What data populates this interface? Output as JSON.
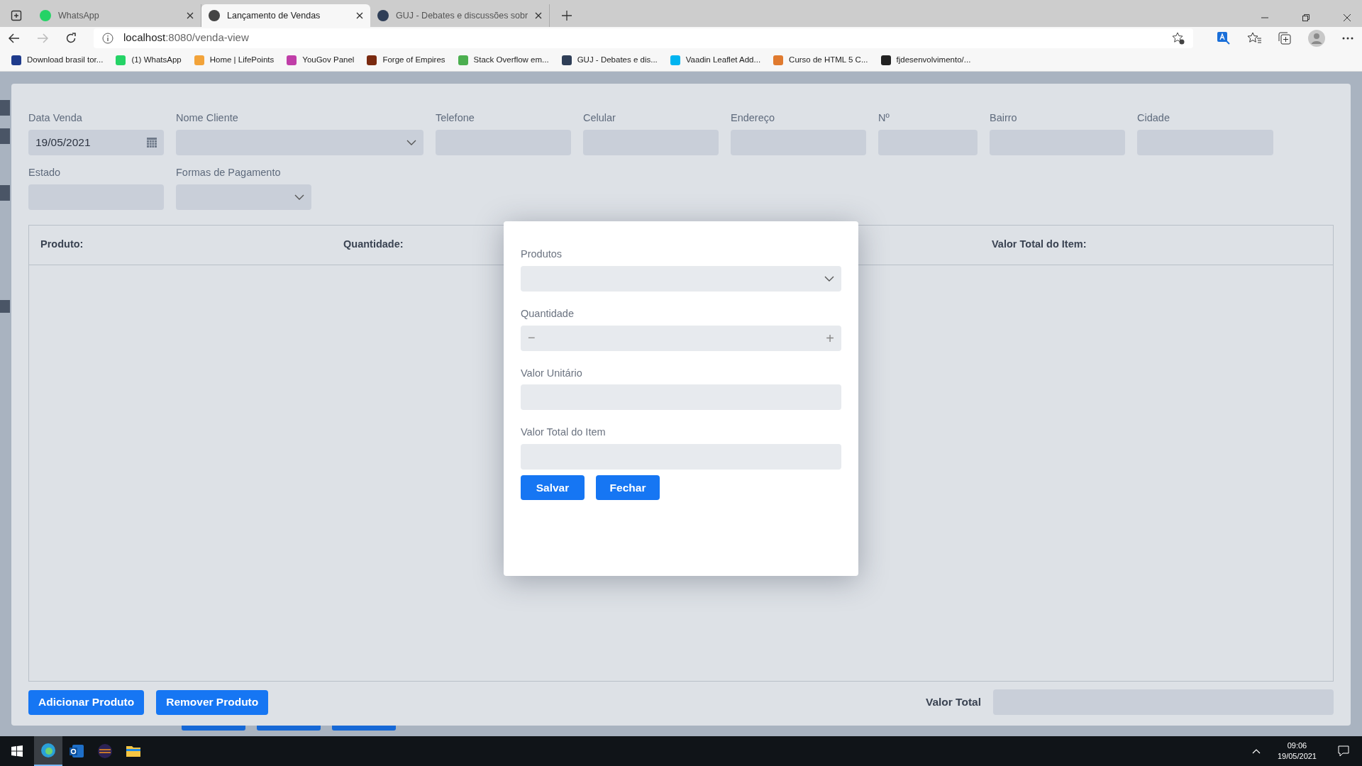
{
  "browser": {
    "tabs": [
      {
        "title": "WhatsApp",
        "selected": false,
        "color": "#25d366"
      },
      {
        "title": "Lançamento de Vendas",
        "selected": true,
        "color": "#444444"
      },
      {
        "title": "GUJ - Debates e discussões sobr",
        "selected": false,
        "color": "#2f3e57"
      }
    ],
    "address": {
      "host": "localhost",
      "path": ":8080/venda-view"
    },
    "bookmarks": [
      {
        "label": "Download brasil tor...",
        "color": "#1f3b8c"
      },
      {
        "label": "(1) WhatsApp",
        "color": "#25d366"
      },
      {
        "label": "Home | LifePoints",
        "color": "#f2a33a"
      },
      {
        "label": "YouGov Panel",
        "color": "#c03ea8"
      },
      {
        "label": "Forge of Empires",
        "color": "#7a2a10"
      },
      {
        "label": "Stack Overflow em...",
        "color": "#4caf50"
      },
      {
        "label": "GUJ - Debates e dis...",
        "color": "#2f3e57"
      },
      {
        "label": "Vaadin Leaflet Add...",
        "color": "#00b4f0"
      },
      {
        "label": "Curso de HTML 5 C...",
        "color": "#e07a2f"
      },
      {
        "label": "fjdesenvolvimento/...",
        "color": "#222222"
      }
    ]
  },
  "form": {
    "rows": [
      [
        {
          "label": "Data Venda",
          "kind": "date",
          "value": "19/05/2021"
        },
        {
          "label": "Nome Cliente",
          "kind": "select"
        },
        {
          "label": "Telefone",
          "kind": "text"
        },
        {
          "label": "Celular",
          "kind": "text"
        },
        {
          "label": "Endereço",
          "kind": "text"
        },
        {
          "label": "Nº",
          "kind": "text"
        },
        {
          "label": "Bairro",
          "kind": "text"
        },
        {
          "label": "Cidade",
          "kind": "text"
        }
      ],
      [
        {
          "label": "Estado",
          "kind": "text"
        },
        {
          "label": "Formas de Pagamento",
          "kind": "select"
        }
      ]
    ],
    "table": {
      "columns": [
        "Produto:",
        "Quantidade:",
        "Valor Total do Item:"
      ]
    },
    "buttons": [
      "Adicionar Produto",
      "Remover Produto"
    ],
    "total_label": "Valor Total"
  },
  "modal": {
    "fields": [
      {
        "label": "Produtos",
        "kind": "select"
      },
      {
        "label": "Quantidade",
        "kind": "stepper",
        "minus": "−",
        "plus": "+"
      },
      {
        "label": "Valor Unitário",
        "kind": "text"
      },
      {
        "label": "Valor Total do Item",
        "kind": "text"
      }
    ],
    "buttons": [
      "Salvar",
      "Fechar"
    ]
  },
  "taskbar": {
    "apps": [
      {
        "selected": true
      },
      {
        "selected": false
      },
      {
        "selected": false
      },
      {
        "selected": false
      }
    ],
    "time": "09:06",
    "date": "19/05/2021"
  }
}
